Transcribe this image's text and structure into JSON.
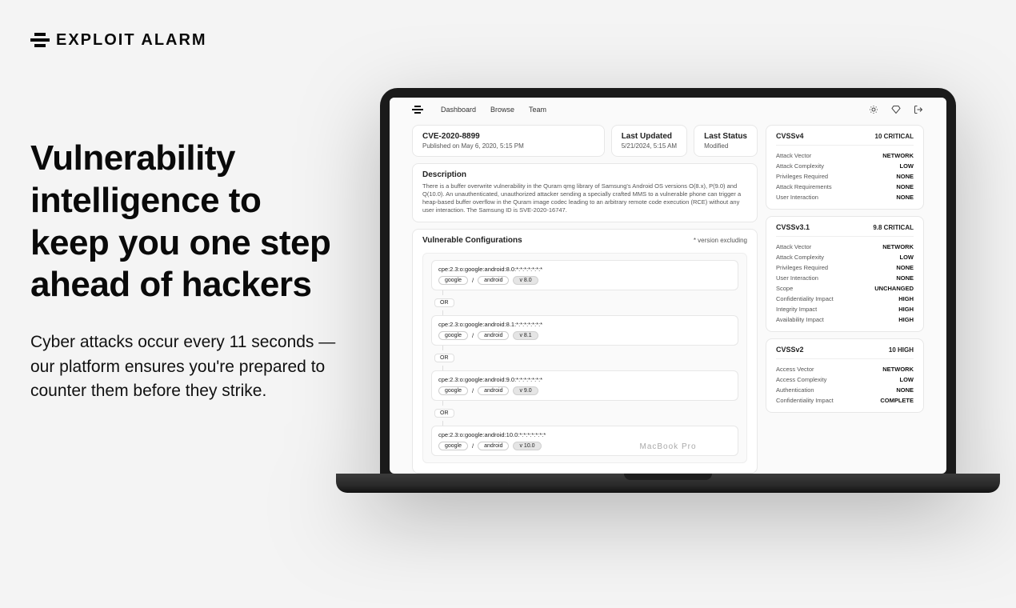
{
  "logo": "EXPLOIT ALARM",
  "hero": {
    "title": "Vulnerability intelligence to keep you one step ahead of hackers",
    "subtitle": "Cyber attacks occur every 11 seconds — our platform ensures you're prepared to counter them before they strike."
  },
  "laptop_label": "MacBook Pro",
  "app": {
    "nav": {
      "dashboard": "Dashboard",
      "browse": "Browse",
      "team": "Team"
    },
    "cve": {
      "id": "CVE-2020-8899",
      "published": "Published on May 6, 2020, 5:15 PM",
      "last_updated_label": "Last Updated",
      "last_updated_value": "5/21/2024, 5:15 AM",
      "last_status_label": "Last Status",
      "last_status_value": "Modified",
      "desc_label": "Description",
      "desc": "There is a buffer overwrite vulnerability in the Quram qmg library of Samsung's Android OS versions O(8.x), P(9.0) and Q(10.0). An unauthenticated, unauthorized attacker sending a specially crafted MMS to a vulnerable phone can trigger a heap-based buffer overflow in the Quram image codec leading to an arbitrary remote code execution (RCE) without any user interaction. The Samsung ID is SVE-2020-16747."
    },
    "vuln": {
      "title": "Vulnerable Configurations",
      "note": "* version excluding",
      "or": "OR",
      "slash": "/",
      "items": [
        {
          "cpe": "cpe:2.3:o:google:android:8.0:*:*:*:*:*:*:*",
          "p1": "google",
          "p2": "android",
          "ver": "v 8.0"
        },
        {
          "cpe": "cpe:2.3:o:google:android:8.1:*:*:*:*:*:*:*",
          "p1": "google",
          "p2": "android",
          "ver": "v 8.1"
        },
        {
          "cpe": "cpe:2.3:o:google:android:9.0:*:*:*:*:*:*:*",
          "p1": "google",
          "p2": "android",
          "ver": "v 9.0"
        },
        {
          "cpe": "cpe:2.3:o:google:android:10.0:*:*:*:*:*:*:*",
          "p1": "google",
          "p2": "android",
          "ver": "v 10.0"
        }
      ]
    },
    "cvss": [
      {
        "title": "CVSSv4",
        "score": "10 CRITICAL",
        "rows": [
          {
            "k": "Attack Vector",
            "v": "NETWORK"
          },
          {
            "k": "Attack Complexity",
            "v": "LOW"
          },
          {
            "k": "Privileges Required",
            "v": "NONE"
          },
          {
            "k": "Attack Requirements",
            "v": "NONE"
          },
          {
            "k": "User Interaction",
            "v": "NONE"
          }
        ]
      },
      {
        "title": "CVSSv3.1",
        "score": "9.8 CRITICAL",
        "rows": [
          {
            "k": "Attack Vector",
            "v": "NETWORK"
          },
          {
            "k": "Attack Complexity",
            "v": "LOW"
          },
          {
            "k": "Privileges Required",
            "v": "NONE"
          },
          {
            "k": "User Interaction",
            "v": "NONE"
          },
          {
            "k": "Scope",
            "v": "UNCHANGED"
          },
          {
            "k": "Confidentiality Impact",
            "v": "HIGH"
          },
          {
            "k": "Integrity Impact",
            "v": "HIGH"
          },
          {
            "k": "Availability Impact",
            "v": "HIGH"
          }
        ]
      },
      {
        "title": "CVSSv2",
        "score": "10 HIGH",
        "rows": [
          {
            "k": "Access Vector",
            "v": "NETWORK"
          },
          {
            "k": "Access Complexity",
            "v": "LOW"
          },
          {
            "k": "Authentication",
            "v": "NONE"
          },
          {
            "k": "Confidentiality Impact",
            "v": "COMPLETE"
          }
        ]
      }
    ]
  }
}
